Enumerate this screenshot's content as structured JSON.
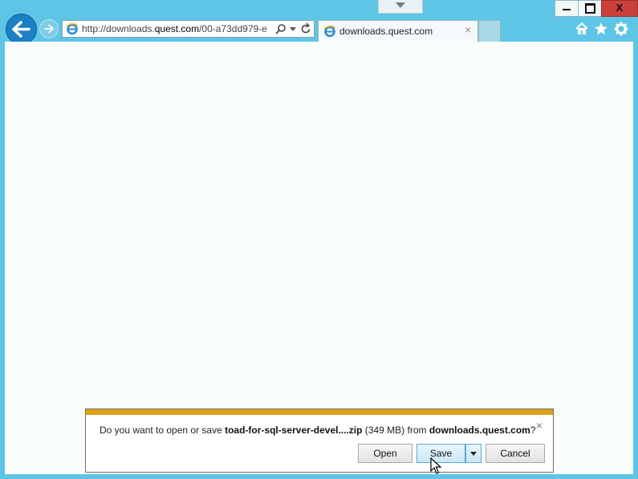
{
  "browser": {
    "address_prefix": "http://downloads.",
    "address_domain": "quest.com",
    "address_suffix": "/00-a73dd979-e",
    "tab_title": "downloads.quest.com",
    "tab_close": "×"
  },
  "window": {
    "close_glyph": "X"
  },
  "notification": {
    "msg_before": "Do you want to open or save ",
    "file_name": "toad-for-sql-server-devel....zip",
    "file_size": " (349 MB) from ",
    "source": "downloads.quest.com",
    "msg_after": "?",
    "close": "×",
    "open_label": "Open",
    "save_label": "Save",
    "cancel_label": "Cancel"
  },
  "colors": {
    "chrome": "#5ec5e6",
    "back_button": "#1b80c4",
    "notification_bar": "#d9a31a",
    "close_button": "#c9413a"
  },
  "icons": [
    "back-arrow-icon",
    "forward-arrow-icon",
    "ie-icon",
    "search-icon",
    "dropdown-icon",
    "refresh-icon",
    "home-icon",
    "favorites-star-icon",
    "gear-icon",
    "close-icon",
    "cursor-icon"
  ]
}
